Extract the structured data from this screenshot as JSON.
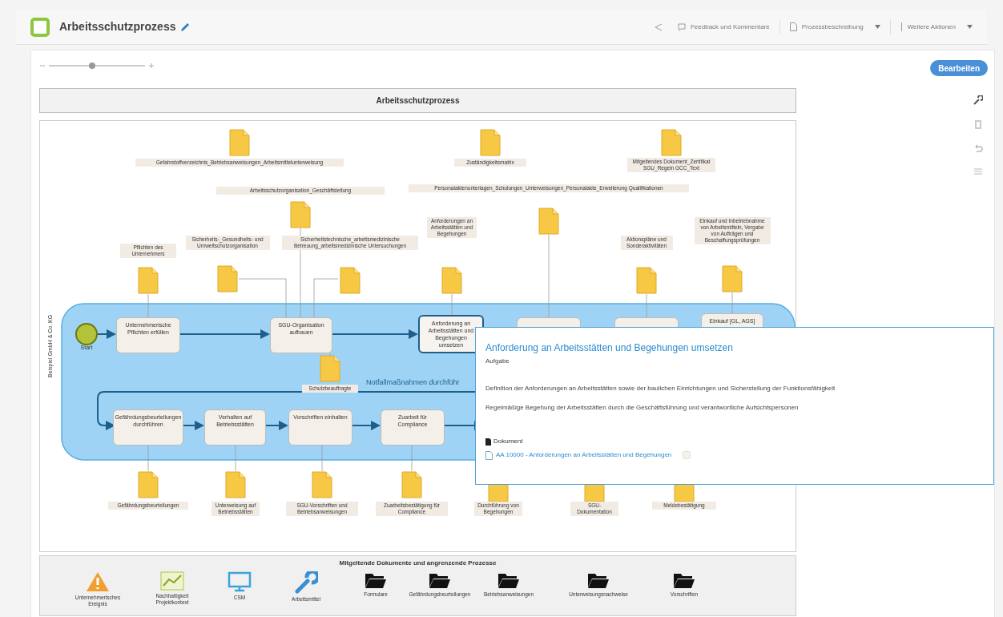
{
  "header": {
    "title": "Arbeitsschutzprozess",
    "actions": [
      {
        "label": "Feedback und Kommentare",
        "kind": "comment",
        "dropdown": false
      },
      {
        "label": "Prozessbeschreibung",
        "kind": "document",
        "dropdown": true
      },
      {
        "label": "Weitere Aktionen",
        "kind": "more",
        "dropdown": true
      }
    ]
  },
  "zoom": {
    "level": 0.45
  },
  "edit_button": "Bearbeiten",
  "diagram": {
    "title": "Arbeitsschutzprozess",
    "lane_label": "Beispiel GmbH & Co. KG",
    "start_label": "Start",
    "subprocess_label": "Notfallmaßnahmen durchführ",
    "tasks": [
      {
        "label": "Unternehmerische Pflichten erfüllen",
        "selected": false
      },
      {
        "label": "SGU-Organisation aufbauen",
        "selected": false
      },
      {
        "label": "Anforderung an Arbeitsstätten und Begehungen umsetzen",
        "selected": true
      },
      {
        "label": "Einkauf [GL, AGS]",
        "selected": false
      },
      {
        "label": "Gefährdungsbeurteilungen durchführen",
        "selected": false
      },
      {
        "label": "Verhalten auf Betriebsstätten",
        "selected": false
      },
      {
        "label": "Vorschriften einhalten",
        "selected": false
      },
      {
        "label": "Zuarbeit für Compliance",
        "selected": false
      }
    ],
    "documents": [
      {
        "label": "Gefahrstoffverzeichnis_Betriebsanweisungen_Arbeitsmittelunterweisung"
      },
      {
        "label": "Zuständigkeitsmatrix"
      },
      {
        "label": "Mitgeltendes Dokument_Zertifikat SGU_Regeln GCC_Text"
      },
      {
        "label": "Arbeitsschutzorganisation_Geschäftsleitung"
      },
      {
        "label": "Personalaktenunterlagen_Schulungen_Unterweisungen_Personalakte_Erweiterung Qualifikationen"
      },
      {
        "label": "Pflichten des Unternehmers"
      },
      {
        "label": "Sicherheits-_Gesundheits- und Umweltschutzorganisation"
      },
      {
        "label": "Sicherheitstechnische_arbeitsmedizinische Betreuung_arbeitsmedizinische Untersuchungen"
      },
      {
        "label": "Anforderungen an Arbeitsstätten und Begehungen"
      },
      {
        "label": "Aktionspläne und Sonderaktivitäten"
      },
      {
        "label": "Einkauf und Inbetriebnahme von Arbeitsmitteln, Vergabe von Aufträgen und Beschaffungsprüfungen"
      },
      {
        "label": "Schutzbeauftragte"
      },
      {
        "label": "Gefährdungsbeurteilungen"
      },
      {
        "label": "Unterweisung auf Betriebsstätten"
      },
      {
        "label": "SGU-Vorschriften und Betriebsanweisungen"
      },
      {
        "label": "Zuarbeitsbestätigung für Compliance"
      },
      {
        "label": "Durchführung von Begehungen"
      },
      {
        "label": "SGU-Dokumentation"
      },
      {
        "label": "Meldebestätigung"
      }
    ],
    "popup": {
      "title": "Anforderung an Arbeitsstätten und Begehungen umsetzen",
      "type": "Aufgabe",
      "paragraphs": [
        "Definition der Anforderungen an Arbeitsstätten sowie der baulichen Einrichtungen und Sicherstellung der Funktionsfähigkeit",
        "Regelmäßige Begehung der Arbeitsstätten durch die Geschäftsführung und verantwortliche Aufsichtspersonen"
      ],
      "document_heading": "Dokument",
      "document_link": "AA 10000 - Anforderungen an Arbeitsstätten und Begehungen"
    }
  },
  "related": {
    "title": "Mitgeltende Dokumente und angrenzende Prozesse",
    "items": [
      {
        "label": "Unternehmerisches Ereignis",
        "kind": "warning"
      },
      {
        "label": "Nachhaltigkeit Projektkontext",
        "kind": "chart"
      },
      {
        "label": "CSM",
        "kind": "monitor"
      },
      {
        "label": "Arbeitsmittel",
        "kind": "wrench"
      },
      {
        "label": "Formulare",
        "kind": "folder"
      },
      {
        "label": "Gefährdungsbeurteilungen",
        "kind": "folder"
      },
      {
        "label": "Betriebsanweisungen",
        "kind": "folder"
      },
      {
        "label": "Unterweisungsnachweise",
        "kind": "folder"
      },
      {
        "label": "Vorschriften",
        "kind": "folder"
      }
    ]
  }
}
